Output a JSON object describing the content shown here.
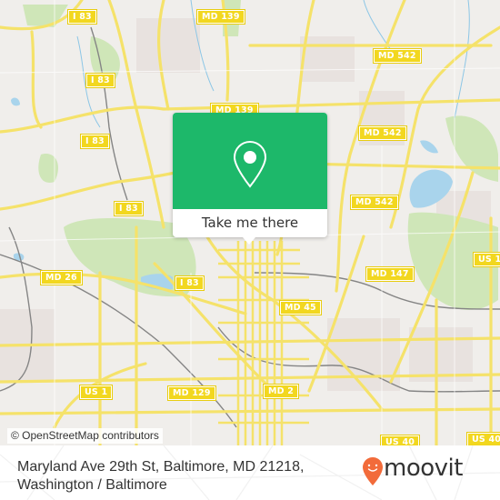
{
  "map": {
    "attribution": "© OpenStreetMap contributors",
    "colors": {
      "land": "#f0eeeb",
      "road": "#f5e26a",
      "park": "#cfe6b8",
      "water": "#a9d4ec",
      "rail": "#7a7a7a",
      "shield_bg": "#f2d71f"
    },
    "road_shields": [
      {
        "label": "I 83"
      },
      {
        "label": "I 83"
      },
      {
        "label": "I 83"
      },
      {
        "label": "I 83"
      },
      {
        "label": "I 83"
      },
      {
        "label": "MD 139"
      },
      {
        "label": "MD 139"
      },
      {
        "label": "MD 542"
      },
      {
        "label": "MD 542"
      },
      {
        "label": "MD 542"
      },
      {
        "label": "MD 26"
      },
      {
        "label": "MD 147"
      },
      {
        "label": "MD 45"
      },
      {
        "label": "MD 129"
      },
      {
        "label": "MD 2"
      },
      {
        "label": "US 1"
      },
      {
        "label": "US 1"
      },
      {
        "label": "US 40"
      },
      {
        "label": "US 40"
      }
    ]
  },
  "popup": {
    "icon": "map-pin-icon",
    "button_label": "Take me there",
    "color": "#1db86a"
  },
  "footer": {
    "address_line1": "Maryland Ave 29th St, Baltimore, MD 21218,",
    "address_line2": "Washington / Baltimore",
    "logo_text": "moovit",
    "logo_color": "#f26b3a"
  }
}
